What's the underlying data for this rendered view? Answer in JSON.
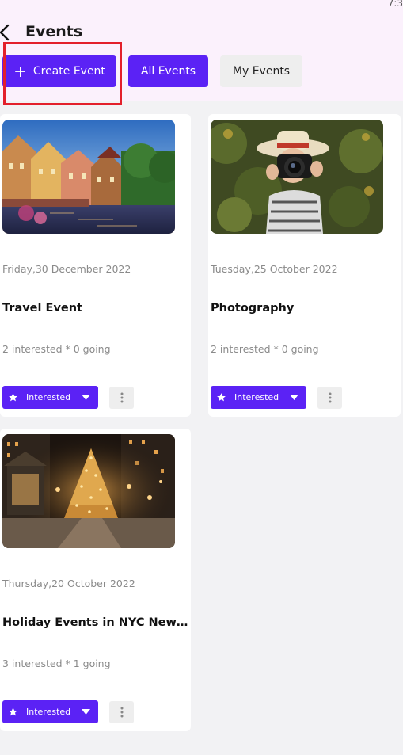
{
  "status_bar": {
    "time": "7:3"
  },
  "header": {
    "title": "Events",
    "buttons": {
      "create_event": "Create Event",
      "all_events": "All Events",
      "my_events": "My Events"
    }
  },
  "colors": {
    "accent": "#5b22f5",
    "header_bg": "#fbf1fc",
    "highlight": "#e3202b"
  },
  "events": [
    {
      "date": "Friday,30 December 2022",
      "title": "Travel Event",
      "stats": "2 interested * 0 going",
      "rsvp_label": "Interested",
      "image": "colorful-canal-town"
    },
    {
      "date": "Tuesday,25 October 2022",
      "title": "Photography",
      "stats": "2 interested * 0 going",
      "rsvp_label": "Interested",
      "image": "photographer-with-camera"
    },
    {
      "date": "Thursday,20 October 2022",
      "title": "Holiday Events in NYC New York",
      "stats": "3 interested * 1 going",
      "rsvp_label": "Interested",
      "image": "christmas-tree-night-park"
    }
  ]
}
